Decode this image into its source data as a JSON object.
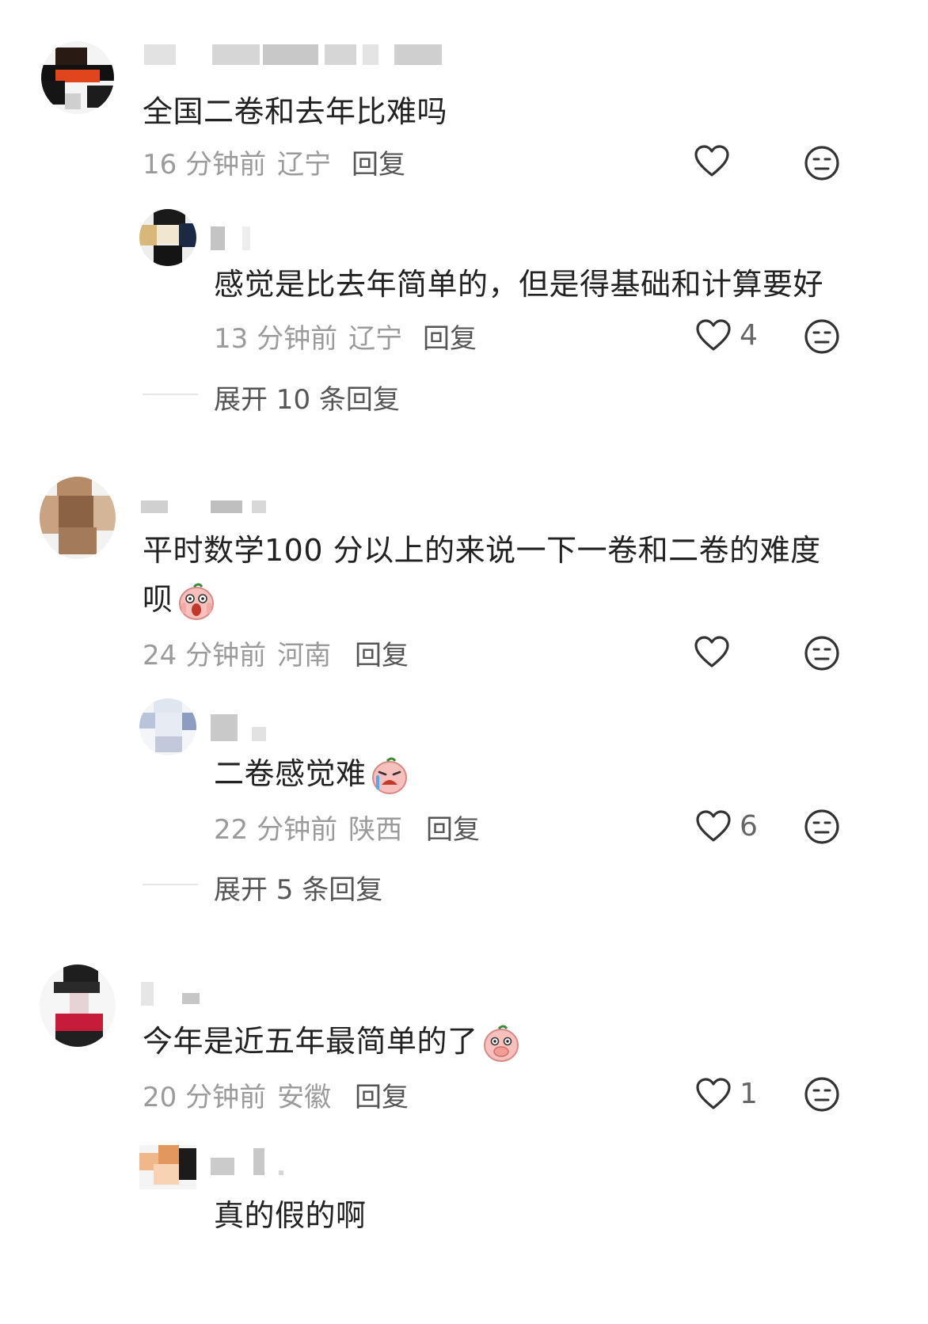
{
  "comments": [
    {
      "text": "全国二卷和去年比难吗",
      "time": "16 分钟前",
      "location": "辽宁",
      "reply_label": "回复",
      "like_count": "",
      "replies": [
        {
          "text": "感觉是比去年简单的，但是得基础和计算要好",
          "time": "13 分钟前",
          "location": "辽宁",
          "reply_label": "回复",
          "like_count": "4"
        }
      ],
      "expand_label": "展开 10 条回复"
    },
    {
      "text_line1": "平时数学100 分以上的来说一下一卷和二卷的难度",
      "text_line2": "呗",
      "time": "24 分钟前",
      "location": "河南",
      "reply_label": "回复",
      "like_count": "",
      "replies": [
        {
          "text": "二卷感觉难",
          "time": "22 分钟前",
          "location": "陕西",
          "reply_label": "回复",
          "like_count": "6"
        }
      ],
      "expand_label": "展开 5 条回复"
    },
    {
      "text": "今年是近五年最简单的了",
      "time": "20 分钟前",
      "location": "安徽",
      "reply_label": "回复",
      "like_count": "1",
      "replies": [
        {
          "text": "真的假的啊"
        }
      ]
    }
  ],
  "icons": {
    "like": "heart-outline-icon",
    "dislike": "neutral-face-icon"
  },
  "colors": {
    "text": "#222222",
    "meta": "#9b9b9b",
    "icon": "#333333"
  }
}
